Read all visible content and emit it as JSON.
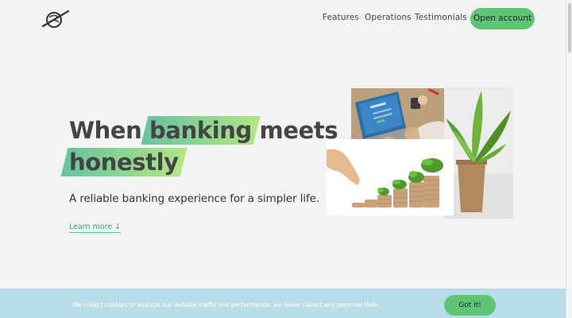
{
  "nav": {
    "logo": "bankist-logo",
    "links": [
      "Features",
      "Operations",
      "Testimonials"
    ],
    "cta": "Open account"
  },
  "hero": {
    "title_line1_pre": "When ",
    "title_hl1": "banking",
    "title_line1_post": " meets",
    "title_hl2": "honestly",
    "subtitle": "A reliable banking experience for a simpler life.",
    "learn_more": "Learn more ↓"
  },
  "cookie": {
    "message": "We collect cookies to analyze our website traffic and performance; we never collect any personal data.",
    "button": "Got it!"
  },
  "colors": {
    "accent": "#5ec576",
    "gradient_start": "#39b385",
    "gradient_end": "#9be15d",
    "cookie_bg": "#b8dde8"
  }
}
